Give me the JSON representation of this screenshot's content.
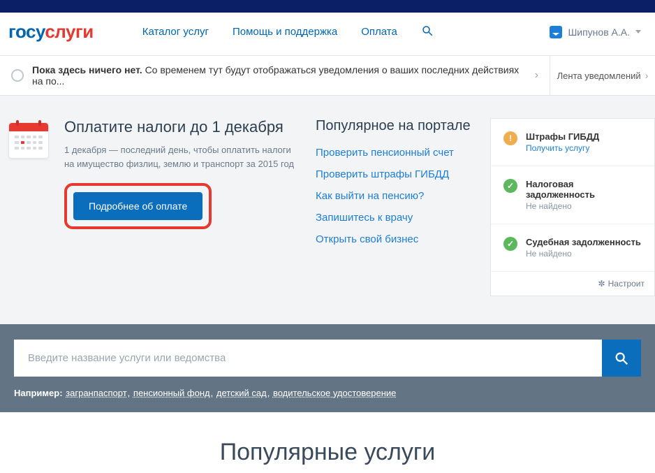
{
  "logo": {
    "part1": "госу",
    "part2": "слуги"
  },
  "nav": {
    "catalog": "Каталог услуг",
    "help": "Помощь и поддержка",
    "payment": "Оплата"
  },
  "user": {
    "name": "Шипунов А.А."
  },
  "notification": {
    "bold": "Пока здесь ничего нет.",
    "rest": "Со временем тут будут отображаться уведомления о ваших последних действиях на по...",
    "feed": "Лента уведомлений"
  },
  "pay": {
    "title": "Оплатите налоги до 1 декабря",
    "desc": "1 декабря — последний день, чтобы оплатить налоги на имущество физлиц, землю и транспорт за 2015 год",
    "button": "Подробнее об оплате"
  },
  "popular": {
    "title": "Популярное на портале",
    "links": [
      "Проверить пенсионный счет",
      "Проверить штрафы ГИБДД",
      "Как выйти на пенсию?",
      "Запишитесь к врачу",
      "Открыть свой бизнес"
    ]
  },
  "status": [
    {
      "kind": "warn",
      "title": "Штрафы ГИБДД",
      "sub": "Получить услугу",
      "subLink": true
    },
    {
      "kind": "ok",
      "title": "Налоговая задолженность",
      "sub": "Не найдено",
      "subLink": false
    },
    {
      "kind": "ok",
      "title": "Судебная задолженность",
      "sub": "Не найдено",
      "subLink": false
    }
  ],
  "configure": "Настроит",
  "search": {
    "placeholder": "Введите название услуги или ведомства",
    "exampleLabel": "Например:",
    "examples": [
      "загранпаспорт",
      "пенсионный фонд",
      "детский сад",
      "водительское удостоверение"
    ]
  },
  "popularServicesTitle": "Популярные услуги"
}
